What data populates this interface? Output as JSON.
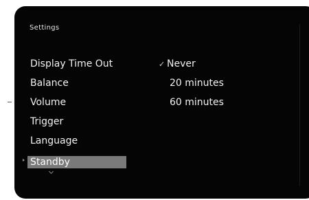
{
  "header": {
    "title": "Settings"
  },
  "menu": {
    "items": [
      {
        "label": "Display Time Out"
      },
      {
        "label": "Balance"
      },
      {
        "label": "Volume"
      },
      {
        "label": "Trigger"
      },
      {
        "label": "Language"
      },
      {
        "label": "Standby",
        "selected": true
      }
    ]
  },
  "options": {
    "items": [
      {
        "label": "Never",
        "checked": true
      },
      {
        "label": "20 minutes",
        "checked": false
      },
      {
        "label": "60 minutes",
        "checked": false
      }
    ],
    "check_glyph": "✓"
  },
  "colors": {
    "background": "#050505",
    "text": "#f2f2f2",
    "highlight": "#7a7a7a"
  },
  "icons": {
    "check": "check-icon",
    "more_below": "chevron-down-icon",
    "selector": "selection-arrow-icon"
  }
}
